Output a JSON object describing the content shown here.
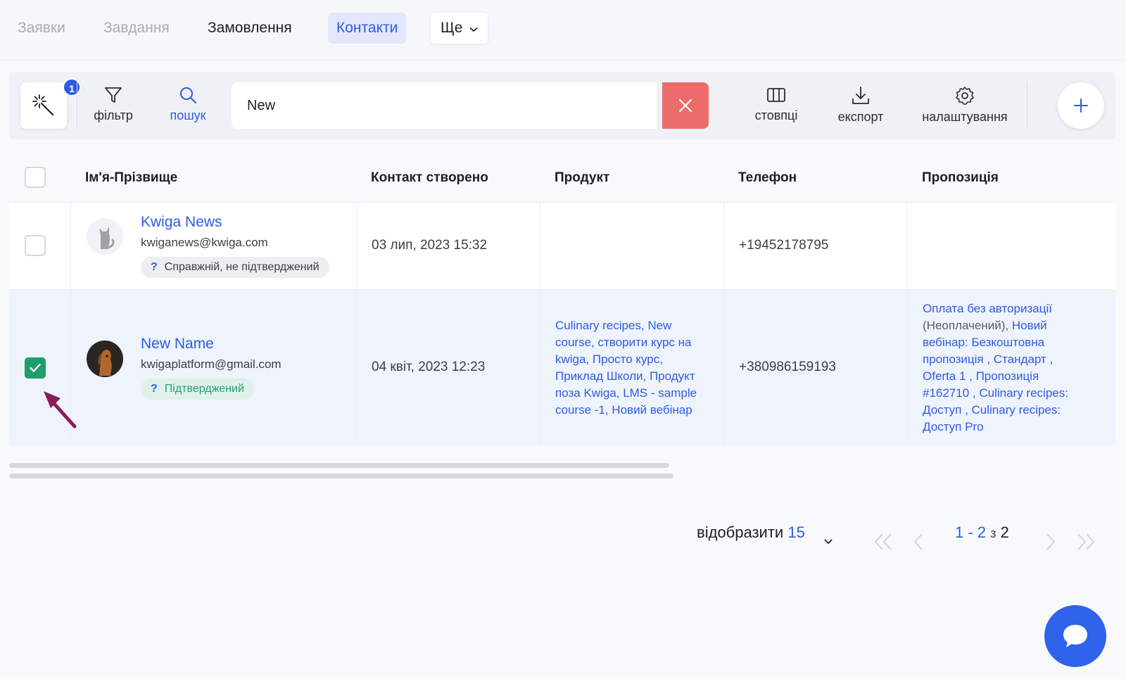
{
  "nav": {
    "tabs": [
      {
        "label": "Заявки",
        "state": "dim"
      },
      {
        "label": "Завдання",
        "state": "dim"
      },
      {
        "label": "Замовлення",
        "state": "normal"
      },
      {
        "label": "Контакти",
        "state": "active"
      }
    ],
    "more_label": "Ще"
  },
  "toolbar": {
    "magic_badge": "1",
    "filter_label": "фільтр",
    "search_label": "пошук",
    "search_value": "New",
    "columns_label": "стовпці",
    "export_label": "експорт",
    "settings_label": "налаштування"
  },
  "table": {
    "columns": [
      "Ім'я-Прізвище",
      "Контакт створено",
      "Продукт",
      "Телефон",
      "Пропозиція"
    ],
    "rows": [
      {
        "checked": false,
        "name": "Kwiga News",
        "email": "kwiganews@kwiga.com",
        "status": "Справжній, не підтверджений",
        "created": "03 лип, 2023 15:32",
        "product": "",
        "phone": "+19452178795",
        "offer": ""
      },
      {
        "checked": true,
        "name": "New Name",
        "email": "kwigaplatform@gmail.com",
        "status": "Підтверджений",
        "created": "04 квіт, 2023 12:23",
        "product_lines": [
          "Culinary recipes, New",
          "course, створити курс на",
          "kwiga, Просто курс,",
          "Приклад Школи, Продукт",
          "поза Kwiga, LMS - sample",
          "course -1, Новий вебінар"
        ],
        "phone": "+380986159193",
        "offer_line1": "Оплата без авторизації",
        "offer_line2_grey": "(Неоплачений),",
        "offer_line2_link": " Новий",
        "offer_lines": [
          "вебінар: Безкоштовна",
          "пропозиція , Стандарт ,",
          "Oferta 1 , Пропозиція",
          "#162710 , Culinary recipes:",
          "Доступ , Culinary recipes:",
          "Доступ Pro"
        ]
      }
    ]
  },
  "pagination": {
    "show_label": "відобразити",
    "per_page": "15",
    "range": "1 - 2",
    "of_label": "з",
    "total": "2"
  },
  "colors": {
    "accent": "#2f5be3",
    "danger": "#ec6c6c",
    "success": "#1f9d6c",
    "annotation_arrow": "#8b1a5a"
  },
  "icons": [
    "magic-wand-icon",
    "filter-icon",
    "search-icon",
    "close-icon",
    "columns-icon",
    "download-icon",
    "gear-icon",
    "plus-icon",
    "chevron-down-icon",
    "double-chevron-left-icon",
    "chevron-left-icon",
    "chevron-right-icon",
    "double-chevron-right-icon",
    "chat-bubble-icon",
    "check-icon"
  ]
}
